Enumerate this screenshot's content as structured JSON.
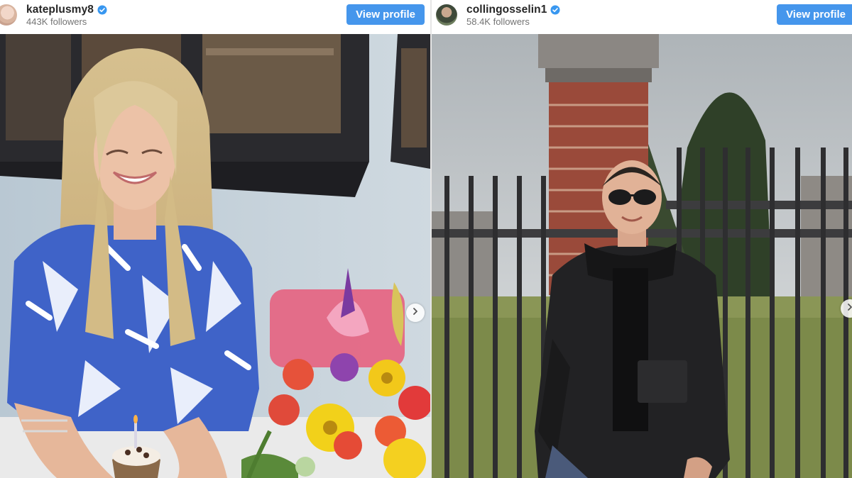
{
  "posts": [
    {
      "username": "kateplusmy8",
      "followers": "443K followers",
      "view_profile_label": "View profile",
      "photo_alt": "kateplusmy8 photo"
    },
    {
      "username": "collingosselin1",
      "followers": "58.4K followers",
      "view_profile_label": "View profile",
      "photo_alt": "collingosselin1 photo"
    }
  ],
  "colors": {
    "button": "#4596ec",
    "verified": "#3897f0",
    "username": "#262626",
    "followers": "#737373"
  },
  "icons": [
    "verified-badge-icon",
    "chevron-right-icon"
  ]
}
